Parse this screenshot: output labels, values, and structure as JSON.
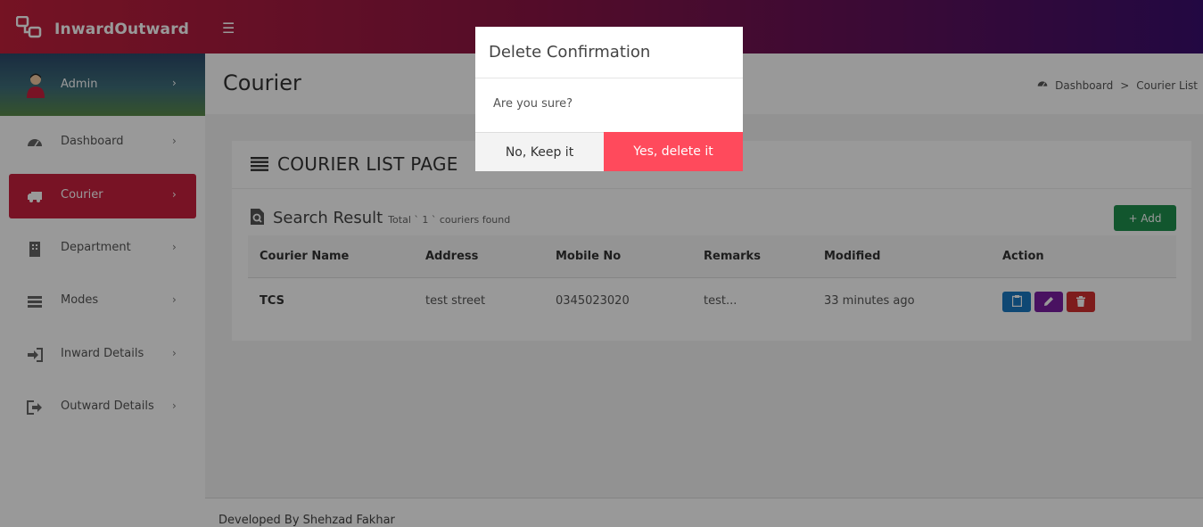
{
  "app": {
    "brand": "InwardOutward",
    "menu_icon": "hamburger-icon"
  },
  "sidebar": {
    "user": {
      "name": "Admin"
    },
    "items": [
      {
        "label": "Dashboard",
        "icon": "dashboard-icon",
        "active": false
      },
      {
        "label": "Courier",
        "icon": "truck-icon",
        "active": true
      },
      {
        "label": "Department",
        "icon": "building-icon",
        "active": false
      },
      {
        "label": "Modes",
        "icon": "list-icon",
        "active": false
      },
      {
        "label": "Inward Details",
        "icon": "sign-in-icon",
        "active": false
      },
      {
        "label": "Outward Details",
        "icon": "sign-out-icon",
        "active": false
      }
    ]
  },
  "header": {
    "title": "Courier",
    "breadcrumb": [
      "Dashboard",
      "Courier List"
    ]
  },
  "card": {
    "title": "COURIER LIST PAGE",
    "search_title": "Search Result",
    "search_summary": "Total ` 1 ` couriers found",
    "add_label": "+ Add"
  },
  "table": {
    "columns": [
      "Courier Name",
      "Address",
      "Mobile No",
      "Remarks",
      "Modified",
      "Action"
    ],
    "rows": [
      {
        "name": "TCS",
        "address": "test street",
        "mobile": "0345023020",
        "remarks": "test...",
        "modified": "33 minutes ago"
      }
    ],
    "action_colors": {
      "view": "#1a78c2",
      "edit": "#7b1fa2",
      "delete": "#d32f2f"
    }
  },
  "footer": {
    "text": "Developed By Shehzad Fakhar"
  },
  "modal": {
    "title": "Delete Confirmation",
    "body": "Are you sure?",
    "cancel_label": "No, Keep it",
    "confirm_label": "Yes, delete it",
    "confirm_color": "#ff4a5c"
  }
}
